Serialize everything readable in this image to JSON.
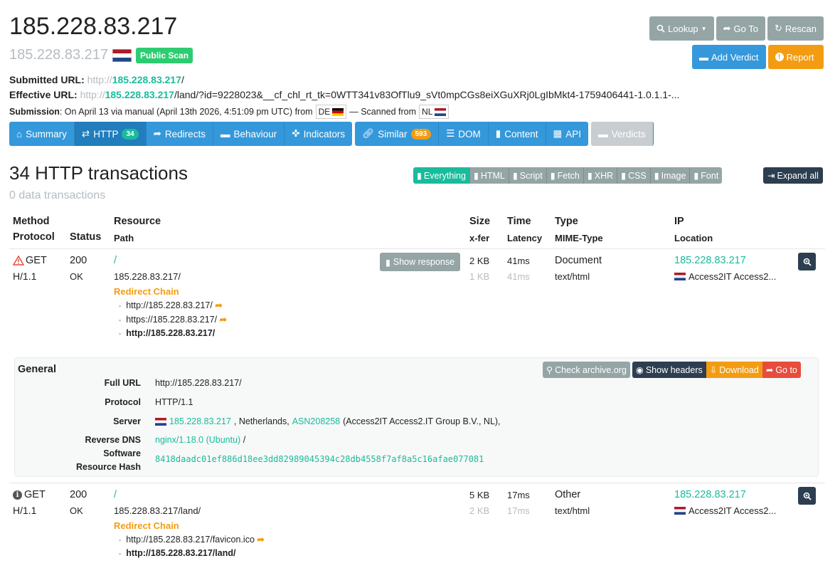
{
  "header": {
    "title": "185.228.83.217",
    "subtitle_ip": "185.228.83.217",
    "public_badge": "Public Scan",
    "lookup": "Lookup",
    "goto": "Go To",
    "rescan": "Rescan",
    "add_verdict": "Add Verdict",
    "report": "Report"
  },
  "submitted": {
    "label": "Submitted URL:",
    "scheme": "http://",
    "host": "185.228.83.217",
    "path": "/"
  },
  "effective": {
    "label": "Effective URL:",
    "scheme": "http://",
    "host": "185.228.83.217",
    "path": "/land/?id=9228023&__cf_chl_rt_tk=0WTT341v83OfTlu9_sVt0mpCGs8eiXGuXRj0LgIbMkt4-1759406441-1.0.1.1-..."
  },
  "submission": {
    "label": "Submission",
    "text": ": On April 13 via manual (April 13th 2026, 4:51:09 pm UTC) from",
    "from_cc": "DE",
    "scanned_text": "— Scanned from",
    "scanned_cc": "NL"
  },
  "tabs": {
    "summary": "Summary",
    "http": "HTTP",
    "http_count": "34",
    "redirects": "Redirects",
    "behaviour": "Behaviour",
    "indicators": "Indicators",
    "similar": "Similar",
    "similar_count": "593",
    "dom": "DOM",
    "content": "Content",
    "api": "API",
    "verdicts": "Verdicts"
  },
  "transactions": {
    "heading": "34 HTTP transactions",
    "sub": "0 data transactions",
    "filters": [
      "Everything",
      "HTML",
      "Script",
      "Fetch",
      "XHR",
      "CSS",
      "Image",
      "Font"
    ],
    "expand_all": "Expand all"
  },
  "table_head": {
    "method": "Method",
    "protocol": "Protocol",
    "status": "Status",
    "resource": "Resource",
    "path": "Path",
    "size": "Size",
    "xfer": "x-fer",
    "time": "Time",
    "latency": "Latency",
    "type": "Type",
    "mime": "MIME-Type",
    "ip": "IP",
    "location": "Location"
  },
  "rows": [
    {
      "method": "GET",
      "protocol": "H/1.1",
      "status": "200",
      "status_text": "OK",
      "resource": "/",
      "path": "185.228.83.217/",
      "show_response": "Show response",
      "size": "2 KB",
      "xfer": "1 KB",
      "time": "41ms",
      "latency": "41ms",
      "type": "Document",
      "mime": "text/html",
      "ip": "185.228.83.217",
      "location": "Access2IT Access2...",
      "chain_title": "Redirect Chain",
      "chain": [
        "http://185.228.83.217/",
        "https://185.228.83.217/",
        "http://185.228.83.217/"
      ]
    },
    {
      "method": "GET",
      "protocol": "H/1.1",
      "status": "200",
      "status_text": "OK",
      "resource": "/",
      "path": "185.228.83.217/land/",
      "size": "5 KB",
      "xfer": "2 KB",
      "time": "17ms",
      "latency": "17ms",
      "type": "Other",
      "mime": "text/html",
      "ip": "185.228.83.217",
      "location": "Access2IT Access2...",
      "chain_title": "Redirect Chain",
      "chain": [
        "http://185.228.83.217/favicon.ico",
        "http://185.228.83.217/land/"
      ]
    }
  ],
  "general": {
    "title": "General",
    "check_archive": "Check archive.org",
    "show_headers": "Show headers",
    "download": "Download",
    "goto": "Go to",
    "full_url_label": "Full URL",
    "full_url": "http://185.228.83.217/",
    "protocol_label": "Protocol",
    "protocol": "HTTP/1.1",
    "server_label": "Server",
    "server_ip": "185.228.83.217",
    "server_country": ", Netherlands,",
    "server_asn": "ASN208258",
    "server_org": "(Access2IT Access2.IT Group B.V., NL),",
    "rdns_label": "Reverse DNS",
    "software_label": "Software",
    "software": "nginx/1.18.0 (Ubuntu)",
    "software_sep": "/",
    "hash_label": "Resource Hash",
    "hash": "8418daadc01ef886d18ee3dd82989045394c28db4558f7af8a5c16afae077081"
  },
  "colors": {
    "green": "#18bc9c",
    "blue": "#3498db",
    "orange": "#f39c12",
    "dark": "#2c3e50",
    "gray": "#95a5a6",
    "red": "#e74c3c"
  }
}
